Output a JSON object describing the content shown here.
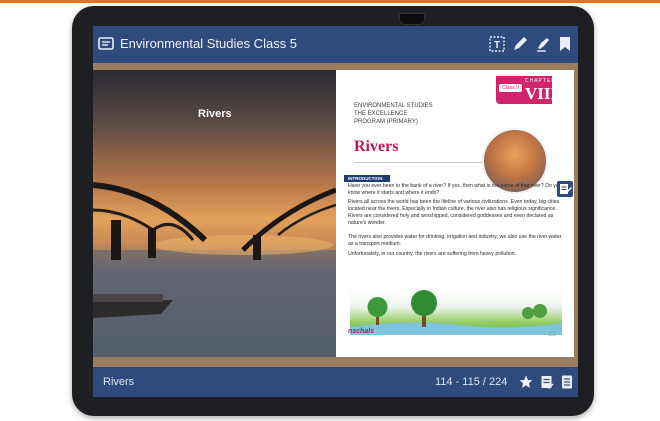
{
  "app": {
    "title": "Environmental Studies Class 5"
  },
  "toolbar": {
    "icons": [
      "text-size-icon",
      "pen-icon",
      "highlighter-icon",
      "bookmark-icon"
    ]
  },
  "spread": {
    "left_page_title": "Rivers",
    "right_page": {
      "chapter_label": "CHAPTER",
      "chapter_number": "VIII",
      "class_label": "Class V",
      "series_lines": [
        "ENVIRONMENTAL STUDIES",
        "THE EXCELLENCE",
        "PROGRAM (PRIMARY)"
      ],
      "chapter_title": "Rivers",
      "section_tab": "INTRODUCTION",
      "paragraphs": [
        "Have you ever been to the bank of a river? If yes, then what is the name of that river? Do you know where it starts and where it ends?",
        "Rivers all across the world has been the lifeline of various civilizations. Even today, big cities located near the rivers. Especially in Indian culture, the river also has religious significance. Rivers are considered holy and worshipped, considered goddesses and even declared as nature's wonder.",
        "The rivers also provides water for drinking, irrigation and industry; we also use the river water as a transport medium.",
        "Unfortunately, in our country, the rivers are suffering from heavy pollution."
      ],
      "publisher": "nschals",
      "page_number": "115"
    }
  },
  "bottom_bar": {
    "title": "Rivers",
    "page_counter": "114 - 115 / 224",
    "icons": [
      "star-icon",
      "notes-icon",
      "contents-icon"
    ]
  },
  "colors": {
    "bar": "#2f4a7c",
    "accent": "#d0246b",
    "chapter_title": "#c2185b"
  }
}
